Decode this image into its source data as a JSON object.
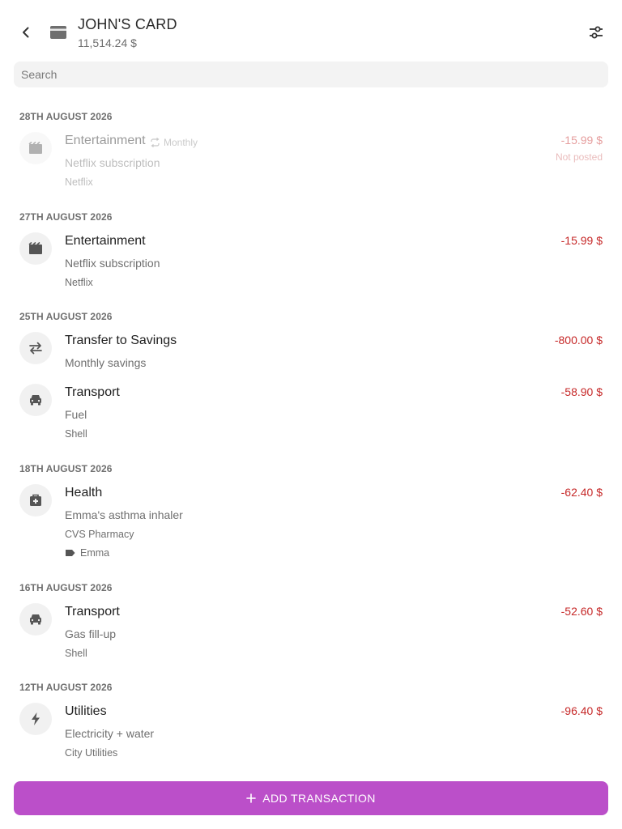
{
  "header": {
    "title": "JOHN'S CARD",
    "balance": "11,514.24 $"
  },
  "search": {
    "placeholder": "Search",
    "value": ""
  },
  "groups": [
    {
      "date": "28TH AUGUST 2026",
      "transactions": [
        {
          "category": "Entertainment",
          "icon": "movie-icon",
          "recurrence": "Monthly",
          "note": "Netflix subscription",
          "payee": "Netflix",
          "amount": "-15.99 $",
          "status": "Not posted"
        }
      ]
    },
    {
      "date": "27TH AUGUST 2026",
      "transactions": [
        {
          "category": "Entertainment",
          "icon": "movie-icon",
          "note": "Netflix subscription",
          "payee": "Netflix",
          "amount": "-15.99 $"
        }
      ]
    },
    {
      "date": "25TH AUGUST 2026",
      "transactions": [
        {
          "category": "Transfer to Savings",
          "icon": "transfer-icon",
          "note": "Monthly savings",
          "amount": "-800.00 $"
        },
        {
          "category": "Transport",
          "icon": "car-icon",
          "note": "Fuel",
          "payee": "Shell",
          "amount": "-58.90 $"
        }
      ]
    },
    {
      "date": "18TH AUGUST 2026",
      "transactions": [
        {
          "category": "Health",
          "icon": "medical-icon",
          "note": "Emma's asthma inhaler",
          "payee": "CVS Pharmacy",
          "tag": "Emma",
          "amount": "-62.40 $"
        }
      ]
    },
    {
      "date": "16TH AUGUST 2026",
      "transactions": [
        {
          "category": "Transport",
          "icon": "car-icon",
          "note": "Gas fill-up",
          "payee": "Shell",
          "amount": "-52.60 $"
        }
      ]
    },
    {
      "date": "12TH AUGUST 2026",
      "transactions": [
        {
          "category": "Utilities",
          "icon": "lightning-icon",
          "note": "Electricity + water",
          "payee": "City Utilities",
          "amount": "-96.40 $"
        }
      ]
    }
  ],
  "add_button": {
    "label": "ADD TRANSACTION"
  },
  "colors": {
    "accent": "#bb4fc9",
    "negative_amount": "#c62828",
    "icon_bg": "#f1f1f1"
  }
}
